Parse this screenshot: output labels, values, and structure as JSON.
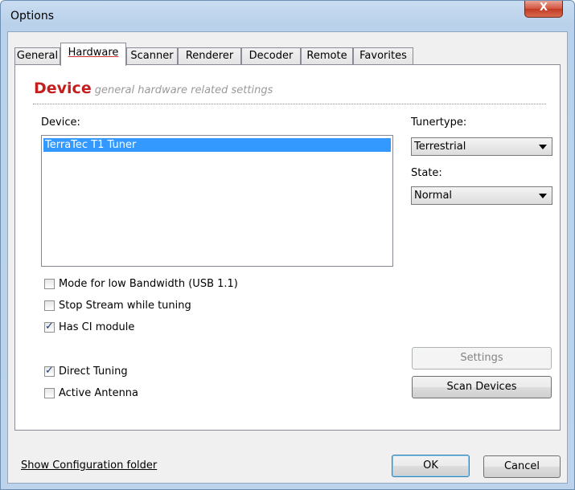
{
  "window": {
    "title": "Options",
    "close_glyph": "X"
  },
  "tabs": [
    {
      "label": "General"
    },
    {
      "label": "Hardware"
    },
    {
      "label": "Scanner"
    },
    {
      "label": "Renderer"
    },
    {
      "label": "Decoder"
    },
    {
      "label": "Remote"
    },
    {
      "label": "Favorites"
    }
  ],
  "active_tab": "Hardware",
  "panel": {
    "heading": "Device",
    "subheading": "general hardware related settings"
  },
  "device": {
    "label": "Device:",
    "items": [
      "TerraTec T1 Tuner"
    ],
    "selected": "TerraTec T1 Tuner"
  },
  "tunertype": {
    "label": "Tunertype:",
    "value": "Terrestrial"
  },
  "state": {
    "label": "State:",
    "value": "Normal"
  },
  "options": [
    {
      "label": "Mode for low Bandwidth (USB 1.1)",
      "checked": false
    },
    {
      "label": "Stop Stream while tuning",
      "checked": false
    },
    {
      "label": "Has CI module",
      "checked": true
    },
    {
      "label": "Direct Tuning",
      "checked": true
    },
    {
      "label": "Active Antenna",
      "checked": false
    }
  ],
  "check_glyph": "✓",
  "buttons": {
    "settings": "Settings",
    "scan_devices": "Scan Devices",
    "ok": "OK",
    "cancel": "Cancel"
  },
  "footer": {
    "link": "Show Configuration folder"
  },
  "colors": {
    "heading": "#c41e1e",
    "selection": "#3399ff",
    "close": "#c13a24"
  }
}
